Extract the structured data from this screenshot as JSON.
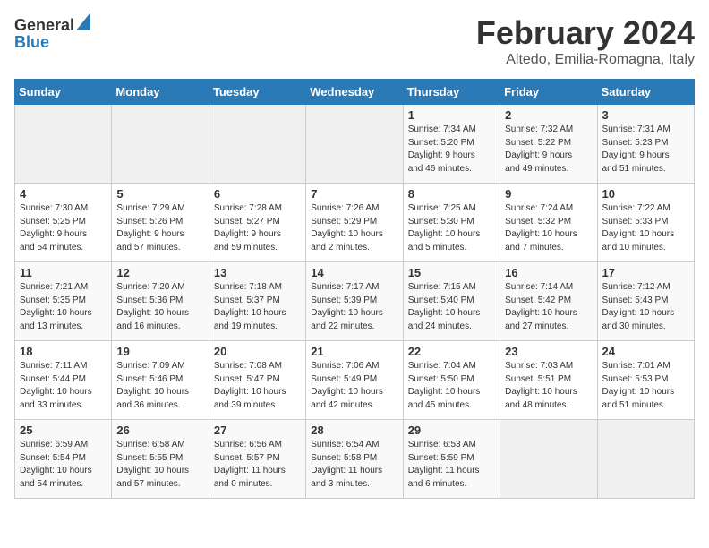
{
  "logo": {
    "general": "General",
    "blue": "Blue"
  },
  "header": {
    "month": "February 2024",
    "location": "Altedo, Emilia-Romagna, Italy"
  },
  "weekdays": [
    "Sunday",
    "Monday",
    "Tuesday",
    "Wednesday",
    "Thursday",
    "Friday",
    "Saturday"
  ],
  "weeks": [
    [
      {
        "day": "",
        "info": ""
      },
      {
        "day": "",
        "info": ""
      },
      {
        "day": "",
        "info": ""
      },
      {
        "day": "",
        "info": ""
      },
      {
        "day": "1",
        "info": "Sunrise: 7:34 AM\nSunset: 5:20 PM\nDaylight: 9 hours\nand 46 minutes."
      },
      {
        "day": "2",
        "info": "Sunrise: 7:32 AM\nSunset: 5:22 PM\nDaylight: 9 hours\nand 49 minutes."
      },
      {
        "day": "3",
        "info": "Sunrise: 7:31 AM\nSunset: 5:23 PM\nDaylight: 9 hours\nand 51 minutes."
      }
    ],
    [
      {
        "day": "4",
        "info": "Sunrise: 7:30 AM\nSunset: 5:25 PM\nDaylight: 9 hours\nand 54 minutes."
      },
      {
        "day": "5",
        "info": "Sunrise: 7:29 AM\nSunset: 5:26 PM\nDaylight: 9 hours\nand 57 minutes."
      },
      {
        "day": "6",
        "info": "Sunrise: 7:28 AM\nSunset: 5:27 PM\nDaylight: 9 hours\nand 59 minutes."
      },
      {
        "day": "7",
        "info": "Sunrise: 7:26 AM\nSunset: 5:29 PM\nDaylight: 10 hours\nand 2 minutes."
      },
      {
        "day": "8",
        "info": "Sunrise: 7:25 AM\nSunset: 5:30 PM\nDaylight: 10 hours\nand 5 minutes."
      },
      {
        "day": "9",
        "info": "Sunrise: 7:24 AM\nSunset: 5:32 PM\nDaylight: 10 hours\nand 7 minutes."
      },
      {
        "day": "10",
        "info": "Sunrise: 7:22 AM\nSunset: 5:33 PM\nDaylight: 10 hours\nand 10 minutes."
      }
    ],
    [
      {
        "day": "11",
        "info": "Sunrise: 7:21 AM\nSunset: 5:35 PM\nDaylight: 10 hours\nand 13 minutes."
      },
      {
        "day": "12",
        "info": "Sunrise: 7:20 AM\nSunset: 5:36 PM\nDaylight: 10 hours\nand 16 minutes."
      },
      {
        "day": "13",
        "info": "Sunrise: 7:18 AM\nSunset: 5:37 PM\nDaylight: 10 hours\nand 19 minutes."
      },
      {
        "day": "14",
        "info": "Sunrise: 7:17 AM\nSunset: 5:39 PM\nDaylight: 10 hours\nand 22 minutes."
      },
      {
        "day": "15",
        "info": "Sunrise: 7:15 AM\nSunset: 5:40 PM\nDaylight: 10 hours\nand 24 minutes."
      },
      {
        "day": "16",
        "info": "Sunrise: 7:14 AM\nSunset: 5:42 PM\nDaylight: 10 hours\nand 27 minutes."
      },
      {
        "day": "17",
        "info": "Sunrise: 7:12 AM\nSunset: 5:43 PM\nDaylight: 10 hours\nand 30 minutes."
      }
    ],
    [
      {
        "day": "18",
        "info": "Sunrise: 7:11 AM\nSunset: 5:44 PM\nDaylight: 10 hours\nand 33 minutes."
      },
      {
        "day": "19",
        "info": "Sunrise: 7:09 AM\nSunset: 5:46 PM\nDaylight: 10 hours\nand 36 minutes."
      },
      {
        "day": "20",
        "info": "Sunrise: 7:08 AM\nSunset: 5:47 PM\nDaylight: 10 hours\nand 39 minutes."
      },
      {
        "day": "21",
        "info": "Sunrise: 7:06 AM\nSunset: 5:49 PM\nDaylight: 10 hours\nand 42 minutes."
      },
      {
        "day": "22",
        "info": "Sunrise: 7:04 AM\nSunset: 5:50 PM\nDaylight: 10 hours\nand 45 minutes."
      },
      {
        "day": "23",
        "info": "Sunrise: 7:03 AM\nSunset: 5:51 PM\nDaylight: 10 hours\nand 48 minutes."
      },
      {
        "day": "24",
        "info": "Sunrise: 7:01 AM\nSunset: 5:53 PM\nDaylight: 10 hours\nand 51 minutes."
      }
    ],
    [
      {
        "day": "25",
        "info": "Sunrise: 6:59 AM\nSunset: 5:54 PM\nDaylight: 10 hours\nand 54 minutes."
      },
      {
        "day": "26",
        "info": "Sunrise: 6:58 AM\nSunset: 5:55 PM\nDaylight: 10 hours\nand 57 minutes."
      },
      {
        "day": "27",
        "info": "Sunrise: 6:56 AM\nSunset: 5:57 PM\nDaylight: 11 hours\nand 0 minutes."
      },
      {
        "day": "28",
        "info": "Sunrise: 6:54 AM\nSunset: 5:58 PM\nDaylight: 11 hours\nand 3 minutes."
      },
      {
        "day": "29",
        "info": "Sunrise: 6:53 AM\nSunset: 5:59 PM\nDaylight: 11 hours\nand 6 minutes."
      },
      {
        "day": "",
        "info": ""
      },
      {
        "day": "",
        "info": ""
      }
    ]
  ]
}
